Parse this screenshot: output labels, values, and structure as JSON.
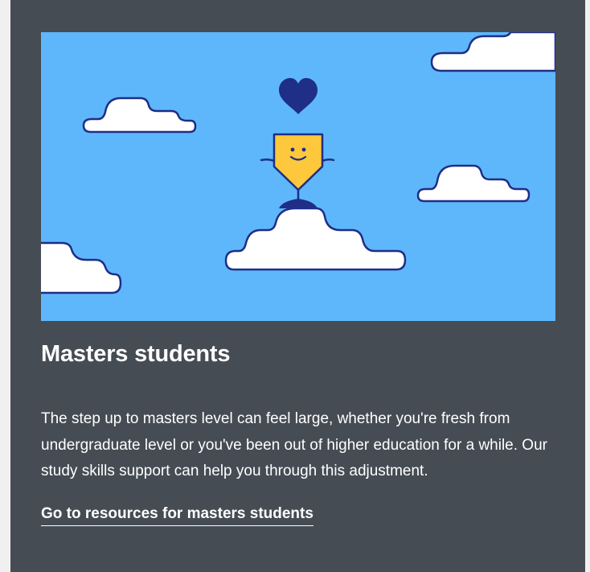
{
  "card": {
    "title": "Masters students",
    "description": "The step up to masters level can feel large, whether you're fresh from undergraduate level or you've been out of higher education for a while. Our study skills support can help you through this adjustment.",
    "link_label": "Go to resources for masters students"
  },
  "colors": {
    "card_background": "#454c54",
    "sky": "#5eb7fa",
    "cloud_fill": "#ffffff",
    "outline": "#1f2e86",
    "character": "#fdc83b",
    "heart": "#1f2e86"
  },
  "illustration": {
    "icons": [
      "heart-icon",
      "smiling-character-icon",
      "cloud-icon"
    ]
  }
}
